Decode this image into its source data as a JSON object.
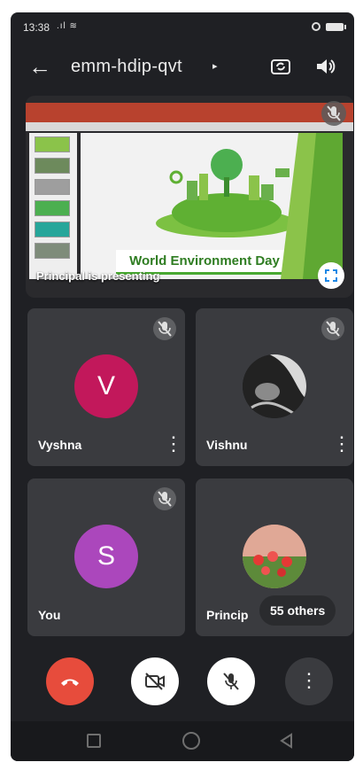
{
  "status_bar": {
    "time": "13:38",
    "signal": ".ıl ≋"
  },
  "top_bar": {
    "meeting_code": "emm-hdip-qvt",
    "caret": "▸"
  },
  "presentation": {
    "caption": "Principal is presenting",
    "slide_title": "World Environment Day"
  },
  "participants": [
    {
      "name": "Vyshna",
      "initial": "V",
      "avatar_color": "#c2185b",
      "muted": true
    },
    {
      "name": "Vishnu",
      "muted": true
    },
    {
      "name": "You",
      "initial": "S",
      "avatar_color": "#ab47bc",
      "muted": true
    },
    {
      "name": "Princip",
      "others_label": "55 others"
    }
  ],
  "controls": {
    "more_glyph": "⋮"
  },
  "colors": {
    "background": "#1f2024",
    "tile": "#3a3b3f",
    "hangup": "#e74c3c"
  }
}
